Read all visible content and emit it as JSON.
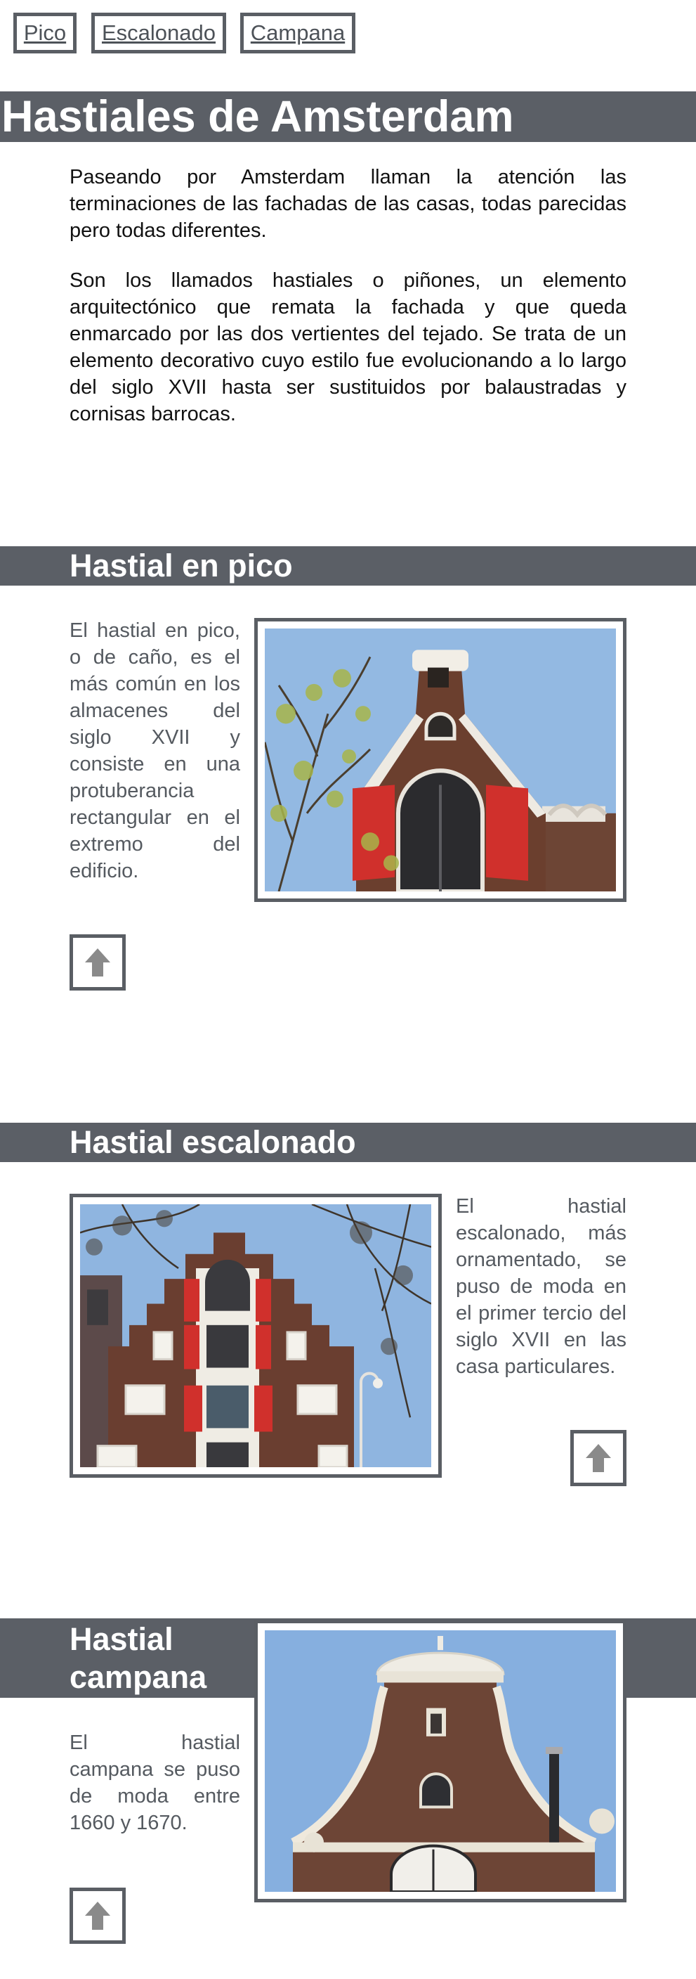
{
  "nav": {
    "pico": "Pico",
    "escalonado": "Escalonado",
    "campana": "Campana"
  },
  "page_title": "Hastiales de Amsterdam",
  "intro": {
    "p1": "Paseando por Amsterdam llaman la atención las terminaciones de las fachadas de las casas, todas parecidas pero todas diferentes.",
    "p2": "Son los llamados hastiales o piñones, un elemento arquitectónico que remata la fachada y que queda enmarcado por las dos vertientes del tejado. Se trata de un elemento decorativo cuyo estilo fue evolucionando a lo largo del siglo XVII hasta ser sustituidos por balaustradas y cornisas barrocas."
  },
  "sections": {
    "pico": {
      "heading": "Hastial en pico",
      "text": "El hastial en pico, o de caño, es el más común en los almacenes del siglo XVII y consiste en una protuberancia rectangular en el extremo del edificio."
    },
    "escalonado": {
      "heading": "Hastial escalonado",
      "text": "El hastial escalonado, más ornamentado, se puso de moda en el primer tercio del siglo XVII en las casa particulares."
    },
    "campana": {
      "heading_line1": "Hastial",
      "heading_line2": "campana",
      "text": "El hastial campana se puso de moda entre 1660 y 1670."
    }
  },
  "icons": {
    "back_to_top": "up-arrow-icon"
  },
  "colors": {
    "band": "#5b5f66",
    "border": "#5a5e64",
    "shutter_red": "#d0302c",
    "sky": "#8fb6e0",
    "brick": "#6b3f2e"
  }
}
